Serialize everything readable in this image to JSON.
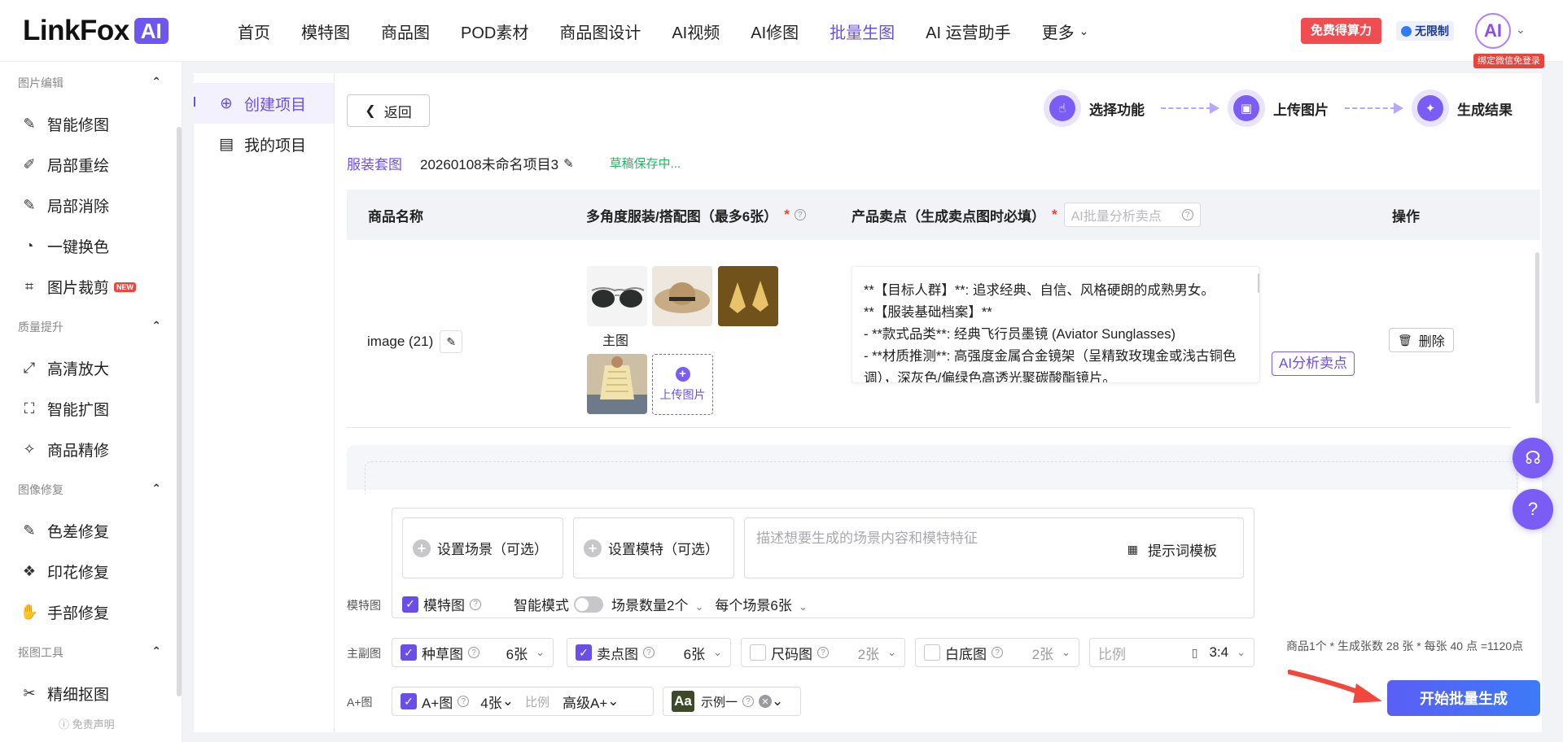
{
  "brand": {
    "logo_text": "LinkFox",
    "logo_ai": "AI"
  },
  "nav": {
    "items": [
      "首页",
      "模特图",
      "商品图",
      "POD素材",
      "商品图设计",
      "AI视频",
      "AI修图",
      "批量生图",
      "AI 运营助手",
      "更多"
    ],
    "active_index": 7,
    "free_btn": "免费得算力",
    "unlimited": "无限制",
    "avatar_text": "AI",
    "avatar_tip": "绑定微信免登录"
  },
  "sidebar": {
    "sections": [
      {
        "title": "图片编辑",
        "items": [
          "智能修图",
          "局部重绘",
          "局部消除",
          "一键换色",
          "图片裁剪"
        ]
      },
      {
        "title": "质量提升",
        "items": [
          "高清放大",
          "智能扩图",
          "商品精修"
        ]
      },
      {
        "title": "图像修复",
        "items": [
          "色差修复",
          "印花修复",
          "手部修复"
        ]
      },
      {
        "title": "抠图工具",
        "items": [
          "精细抠图"
        ]
      }
    ],
    "new_badge": "NEW",
    "disclaimer": "免责声明"
  },
  "panel2": {
    "create": "创建项目",
    "mine": "我的项目"
  },
  "toolbar": {
    "back": "返回"
  },
  "steps": [
    "选择功能",
    "上传图片",
    "生成结果"
  ],
  "crumb": {
    "type": "服装套图",
    "project_name": "20260108未命名项目3",
    "saving": "草稿保存中..."
  },
  "table": {
    "headers": {
      "name": "商品名称",
      "images": "多角度服装/搭配图（最多6张）",
      "points": "产品卖点（生成卖点图时必填）",
      "ai_placeholder": "AI批量分析卖点",
      "ops": "操作"
    },
    "row": {
      "name": "image (21)",
      "main_label": "主图",
      "upload": "上传图片",
      "points_lines": [
        "**【目标人群】**: 追求经典、自信、风格硬朗的成熟男女。",
        "**【服装基础档案】**",
        "- **款式品类**: 经典飞行员墨镜 (Aviator Sunglasses)",
        "- **材质推测**: 高强度金属合金镜架（呈精致玫瑰金或浅古铜色调），深灰色/偏绿色高透光聚碳酸酯镜片。"
      ],
      "ai_btn": "AI分析卖点",
      "delete": "删除"
    }
  },
  "settings": {
    "scene": "设置场景（可选）",
    "model": "设置模特（可选）",
    "desc_placeholder": "描述想要生成的场景内容和模特特征",
    "template": "提示词模板",
    "model_row": {
      "label": "模特图",
      "cb": "模特图",
      "smart": "智能模式",
      "scene_count": "场景数量2个",
      "per_scene": "每个场景6张"
    },
    "main_row": {
      "label": "主副图",
      "items": [
        {
          "name": "种草图",
          "count": "6张",
          "on": true
        },
        {
          "name": "卖点图",
          "count": "6张",
          "on": true
        },
        {
          "name": "尺码图",
          "count": "2张",
          "on": false
        },
        {
          "name": "白底图",
          "count": "2张",
          "on": false
        }
      ],
      "ratio_label": "比例",
      "ratio_value": "3:4"
    },
    "aplus_row": {
      "label": "A+图",
      "cb": "A+图",
      "count": "4张",
      "ratio_label": "比例",
      "level": "高级A+",
      "example": "示例一",
      "font_glyph": "Aa"
    }
  },
  "summary": "商品1个 * 生成张数 28 张 * 每张 40 点 =1120点",
  "start_btn": "开始批量生成",
  "colors": {
    "accent": "#6a4ee9",
    "danger": "#f04d52",
    "success": "#22b55f"
  }
}
